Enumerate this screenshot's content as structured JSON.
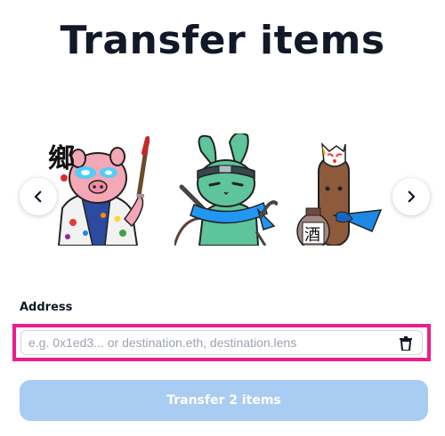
{
  "header": {
    "title": "Transfer items"
  },
  "carousel": {
    "prev_icon": "chevron-left-icon",
    "next_icon": "chevron-right-icon",
    "items": [
      {
        "name": "nft-pig-painter",
        "calligraphy": "鄉"
      },
      {
        "name": "nft-green-rabbit-ninja"
      },
      {
        "name": "nft-fox-mask-sake",
        "calligraphy": "酒"
      }
    ]
  },
  "form": {
    "address_label": "Address",
    "address_value": "",
    "address_placeholder": "e.g. 0x1ed3... or destination.eth, destination.lens",
    "clear_icon": "trash-icon"
  },
  "actions": {
    "transfer_label": "Transfer 2 items"
  },
  "colors": {
    "highlight_border": "#ec1c8c",
    "button_disabled_bg": "#a9ccf2",
    "title_text": "#111827"
  }
}
